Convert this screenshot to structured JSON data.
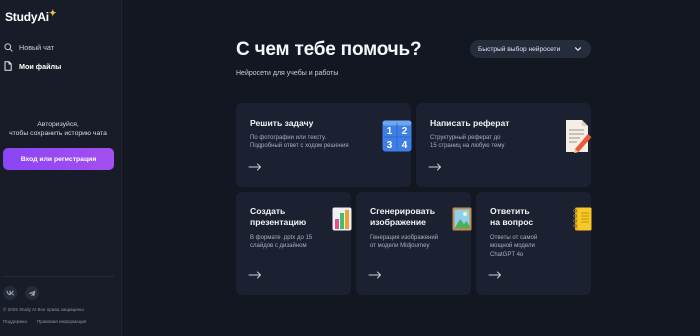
{
  "sidebar": {
    "logo": {
      "study": "Study",
      "ai": "Ai",
      "spark": "✦"
    },
    "nav": [
      {
        "label": "Новый чат",
        "icon": "search-icon"
      },
      {
        "label": "Мои файлы",
        "icon": "file-icon"
      }
    ],
    "auth_prompt_line1": "Авторизуйся,",
    "auth_prompt_line2": "чтобы сохранить историю чата",
    "login_button": "Вход или регистрация",
    "social": [
      {
        "label": "VK",
        "icon": "vk-icon"
      },
      {
        "label": "TG",
        "icon": "telegram-icon"
      }
    ],
    "copyright": "© 2025 Study AI Все права защищены",
    "footer_links": [
      "Поддержка",
      "Правовая информация"
    ]
  },
  "main": {
    "title": "С чем тебе помочь?",
    "subtitle": "Нейросети для учебы и работы",
    "quick_select": "Быстрый выбор нейросети",
    "cards": [
      {
        "title": [
          "Решить задачу"
        ],
        "desc": [
          "По фотографии или тексту.",
          "Подробный ответ с ходом решения"
        ],
        "icon": "numbers-icon"
      },
      {
        "title": [
          "Написать реферат"
        ],
        "desc": [
          "Структурный реферат до",
          "15 страниц на любую тему"
        ],
        "icon": "document-pencil-icon"
      },
      {
        "title": [
          "Создать",
          "презентацию"
        ],
        "desc": [
          "В формате .pptx до 15",
          "слайдов с дизайном"
        ],
        "icon": "bar-chart-icon"
      },
      {
        "title": [
          "Сгенерировать",
          "изображение"
        ],
        "desc": [
          "Генерация изображений",
          "от модели Midjourney"
        ],
        "icon": "picture-icon"
      },
      {
        "title": [
          "Ответить",
          "на вопрос"
        ],
        "desc": [
          "Ответы от самой",
          "мощной модели",
          "ChatGPT 4o"
        ],
        "icon": "notebook-icon"
      }
    ]
  },
  "colors": {
    "background": "#121722",
    "sidebar": "#171c28",
    "card": "#1b2130",
    "accent": "#9a4cf3"
  }
}
